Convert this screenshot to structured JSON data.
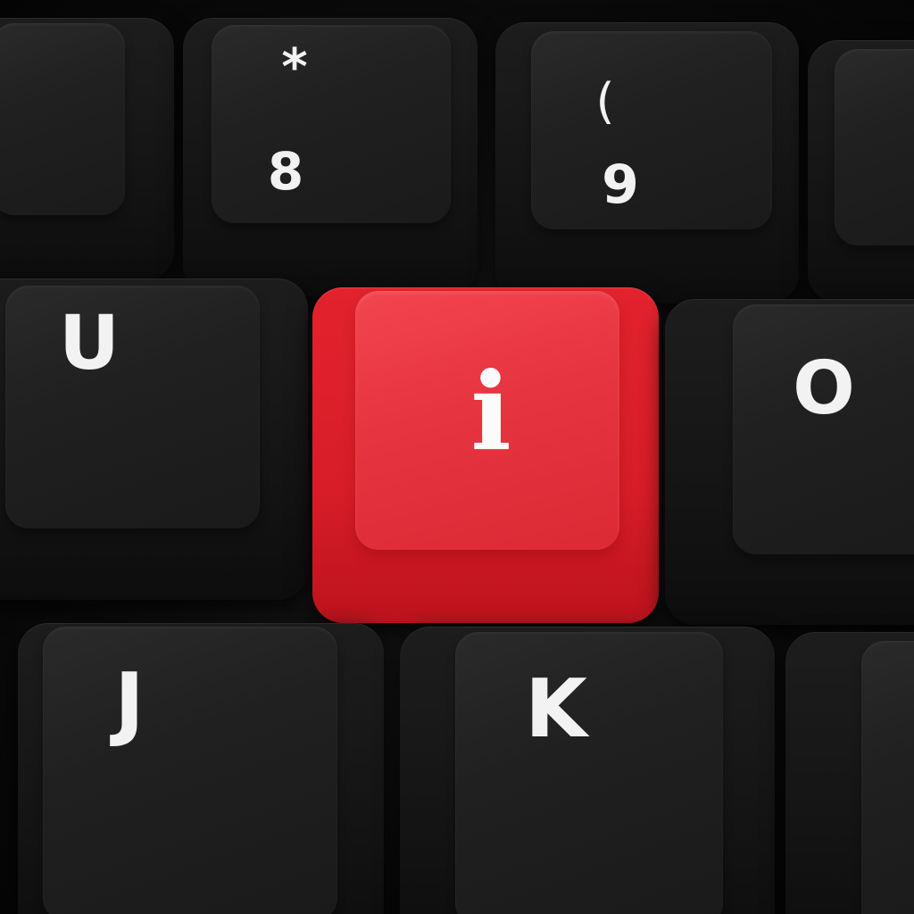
{
  "keyboard": {
    "keys": {
      "top_left": {
        "legend": ""
      },
      "eight": {
        "upper": "*",
        "lower": "8"
      },
      "nine": {
        "upper": "(",
        "lower": "9"
      },
      "top_right": {
        "legend": ""
      },
      "u": {
        "legend": "U"
      },
      "i": {
        "legend": "i"
      },
      "o": {
        "legend": "O"
      },
      "j": {
        "legend": "J"
      },
      "k": {
        "legend": "K"
      },
      "bottom_right": {
        "legend": ""
      }
    },
    "colors": {
      "keycap": "#1a1a1a",
      "accent_keycap": "#e3303b",
      "legend": "#f2f2f2"
    }
  }
}
